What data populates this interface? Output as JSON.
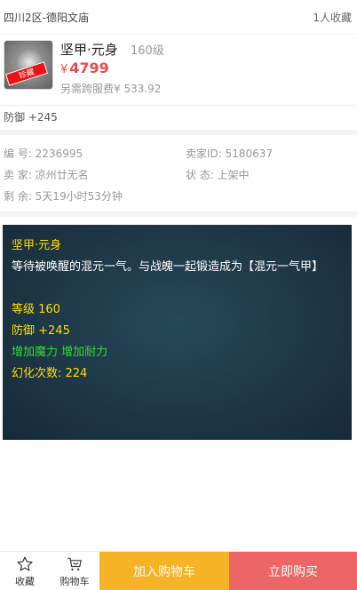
{
  "header": {
    "location": "四川2区-德阳文庙",
    "fav_count": "1人收藏"
  },
  "item": {
    "name": "坚甲·元身",
    "level": "160级",
    "price_symbol": "¥",
    "price": "4799",
    "extra_fee": "另需跨服费¥ 533.92",
    "thumb_stamp": "珍藏"
  },
  "attr": "防御 +245",
  "info": {
    "number": "编  号: 2236995",
    "seller_id": "卖家ID: 5180637",
    "seller": "卖  家: 凉州廿无名",
    "status": "状  态: 上架中",
    "remaining": "剩  余: 5天19小时53分钟"
  },
  "description": {
    "title": "坚甲·元身",
    "text": "等待被唤醒的混元一气。与战魄一起锻造成为【混元一气甲】",
    "level": "等级 160",
    "defense": "防御 +245",
    "bonus": "增加魔力 增加耐力",
    "transform": "幻化次数: 224"
  },
  "bottom_bar": {
    "favorite_label": "收藏",
    "cart_icon_label": "购物车",
    "add_to_cart": "加入购物车",
    "buy_now": "立即购买"
  },
  "colors": {
    "price": "#e94b4b",
    "cart_button": "#f6b325",
    "buy_button": "#ee6565",
    "desc_bg": "#1d3645",
    "desc_yellow": "#ffde00",
    "desc_green": "#33dd33"
  }
}
